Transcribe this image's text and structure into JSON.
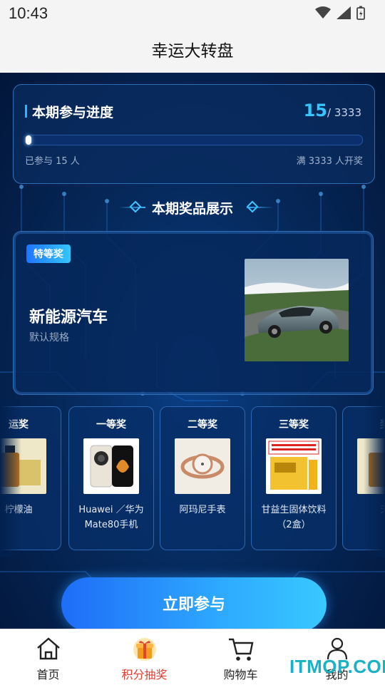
{
  "status": {
    "time": "10:43"
  },
  "header": {
    "title": "幸运大转盘"
  },
  "progress": {
    "title": "本期参与进度",
    "current": "15",
    "total": "/ 3333",
    "fraction": 0.0045,
    "joined_text": "已参与 15 人",
    "threshold_text": "满 3333 人开奖"
  },
  "prize_section": {
    "title": "本期奖品展示"
  },
  "featured": {
    "badge": "特等奖",
    "name": "新能源汽车",
    "spec": "默认规格"
  },
  "prizes": [
    {
      "level": "运奖",
      "name": "柠檬油"
    },
    {
      "level": "一等奖",
      "name": "Huawei ／华为 Mate80手机"
    },
    {
      "level": "二等奖",
      "name": "阿玛尼手表"
    },
    {
      "level": "三等奖",
      "name": "甘益生固体饮料（2盒）"
    },
    {
      "level": "奖",
      "name": "天"
    }
  ],
  "join_button": "立即参与",
  "tabs": [
    {
      "label": "首页",
      "icon": "home-icon"
    },
    {
      "label": "积分抽奖",
      "icon": "gift-icon",
      "active": true
    },
    {
      "label": "购物车",
      "icon": "cart-icon"
    },
    {
      "label": "我的",
      "icon": "user-icon"
    }
  ],
  "watermark": "ITMOP.COM",
  "colors": {
    "accent": "#2ea9ff",
    "active_tab": "#e53b2f",
    "highlight": "#34c6ff"
  }
}
